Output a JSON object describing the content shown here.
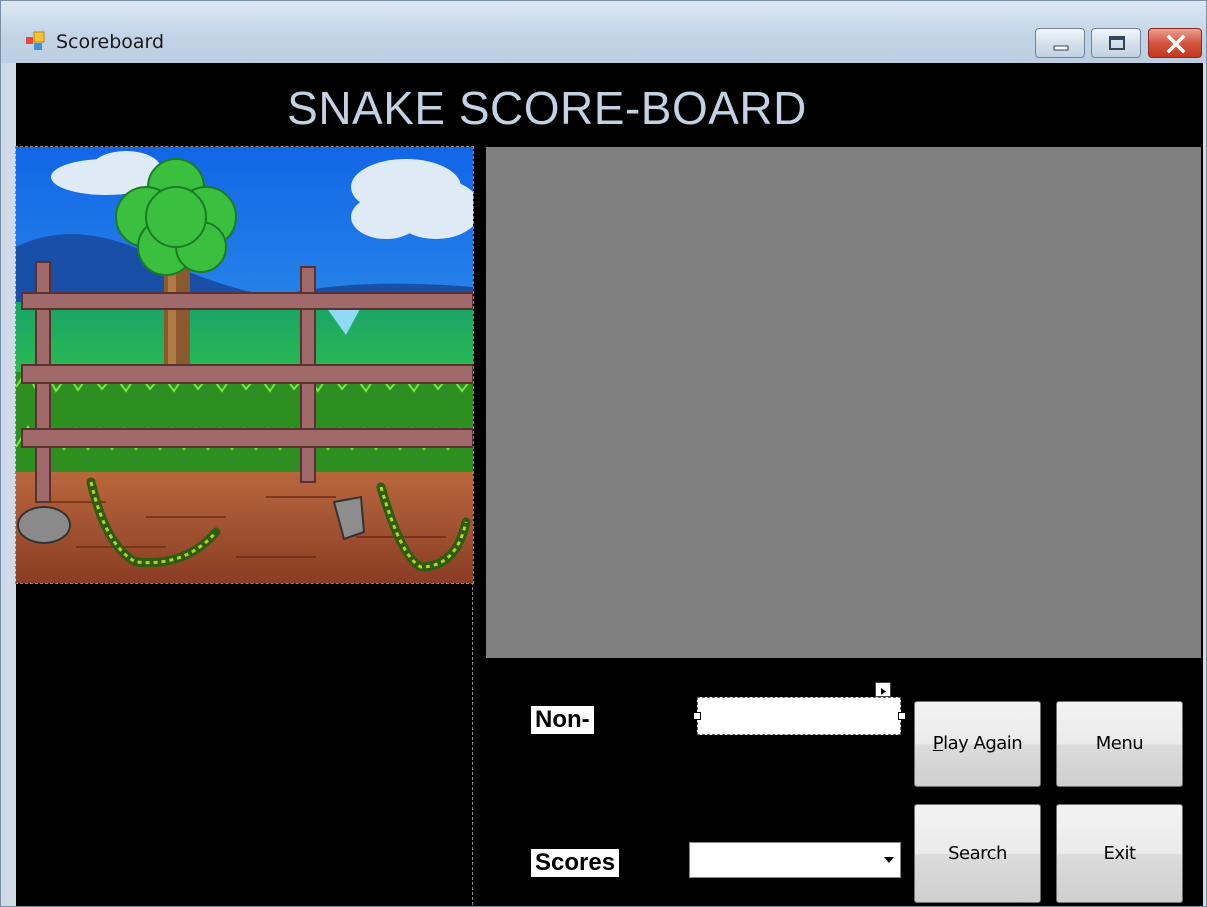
{
  "window": {
    "title": "Scoreboard",
    "minimize_icon": "minimize-icon",
    "maximize_icon": "maximize-icon",
    "close_icon": "close-icon"
  },
  "header": {
    "title": "SNAKE SCORE-BOARD"
  },
  "scene": {
    "icon": "snake-garden-illustration"
  },
  "form": {
    "name_label": "Non-",
    "name_value": "",
    "scores_label": "Scores",
    "scores_selected": ""
  },
  "buttons": {
    "play_again_first": "P",
    "play_again_rest": "lay Again",
    "menu": "Menu",
    "search": "Search",
    "exit": "Exit"
  },
  "colors": {
    "background": "#000000",
    "title_text": "#c3d1e0",
    "grid_area": "#808080"
  }
}
